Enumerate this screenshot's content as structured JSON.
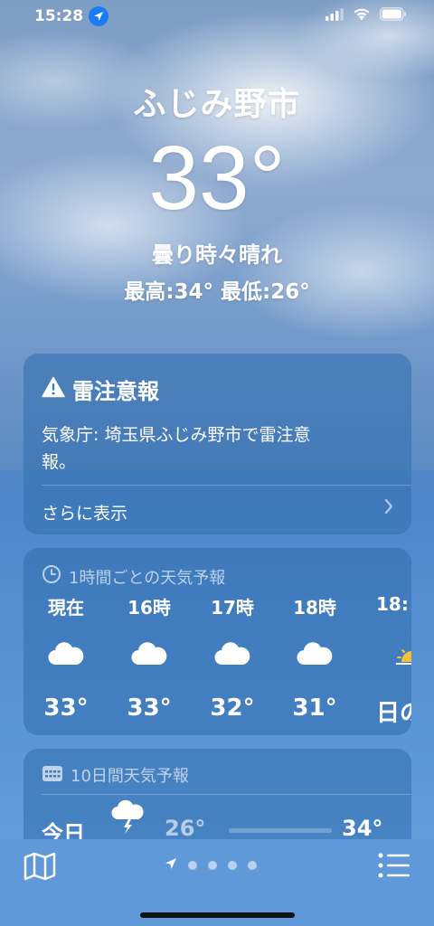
{
  "status_bar": {
    "time": "15:28",
    "location_icon": "location-arrow-icon",
    "signal_icon": "cellular-signal-icon",
    "wifi_icon": "wifi-icon",
    "battery_icon": "battery-icon"
  },
  "hero": {
    "city": "ふじみ野市",
    "temperature": "33°",
    "condition": "曇り時々晴れ",
    "high_low": "最高:34° 最低:26°"
  },
  "alert": {
    "icon": "warning-triangle-icon",
    "title": "雷注意報",
    "body": "気象庁: 埼玉県ふじみ野市で雷注意報。",
    "more_label": "さらに表示"
  },
  "hourly": {
    "header_icon": "clock-icon",
    "header": "1時間ごとの天気予報",
    "hours": [
      {
        "label": "現在",
        "icon": "cloud-icon",
        "temp": "33°"
      },
      {
        "label": "16時",
        "icon": "cloud-icon",
        "temp": "33°"
      },
      {
        "label": "17時",
        "icon": "cloud-icon",
        "temp": "32°"
      },
      {
        "label": "18時",
        "icon": "cloud-icon",
        "temp": "31°"
      },
      {
        "label": "18:",
        "icon": "sunset-icon",
        "temp": "日の"
      }
    ]
  },
  "daily": {
    "header_icon": "calendar-icon",
    "header": "10日間天気予報",
    "days": [
      {
        "label": "今日",
        "icon": "thunderstorm-icon",
        "low": "26°",
        "high": "34°"
      }
    ]
  },
  "bottom_bar": {
    "map_icon": "map-icon",
    "list_icon": "list-icon",
    "pager_current_icon": "location-arrow-icon",
    "page_count": 5
  },
  "colors": {
    "accent_blue": "#1a7cf5",
    "temp_bar_warm": "#f07a2a",
    "temp_bar_cool": "#f4b63a"
  }
}
